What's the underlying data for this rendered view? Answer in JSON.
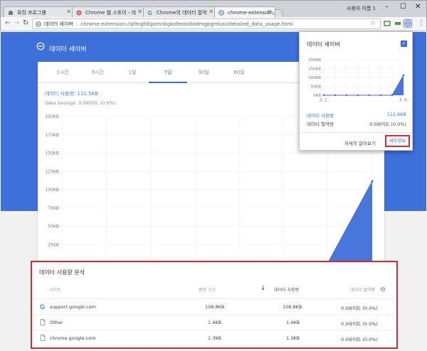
{
  "browser": {
    "tabs": [
      {
        "label": "확장 프로그램"
      },
      {
        "label": "Chrome 웹 스토어 - 데"
      },
      {
        "label": "Chrome의 데이터 절약"
      },
      {
        "label": "chrome-extension://pfm"
      }
    ],
    "username": "사용자 이름 1",
    "window_controls": {
      "minimize": "–",
      "maximize": "☐",
      "close": "✕"
    },
    "address": {
      "site_label": "데이터 세이버",
      "url": "chrome-extension://pfmgfdlgomnbgkofeojodiodmgpgmkac/detailed_data_usage.html"
    }
  },
  "page": {
    "title": "데이터 세이버",
    "range_tabs": [
      "1시간",
      "3시간",
      "1일",
      "7일",
      "30일",
      "60일"
    ],
    "selected_range": "7일",
    "usage_text": "데이터 사용량: 111.5KB",
    "savings_text": "Data Savings: 0.0바이트 (0.0%)"
  },
  "chart_data": [
    {
      "type": "area",
      "title": "",
      "x": [
        "3. 2.",
        "3. 3.",
        "3. 4.",
        "3. 5.",
        "3. 6.",
        "3. 7.",
        "3. 8.",
        "3. 9."
      ],
      "x_tick_labels": [
        "3. 2.",
        "3. 9."
      ],
      "y_ticks": [
        "0KB",
        "25KB",
        "50KB",
        "75KB",
        "100KB",
        "125KB",
        "150KB",
        "175KB",
        "200KB"
      ],
      "series": [
        {
          "values": [
            0,
            0,
            0,
            0,
            0,
            0,
            0,
            111.5
          ]
        }
      ],
      "ylim": [
        0,
        200
      ],
      "grid": true
    },
    {
      "type": "area",
      "title": "",
      "x": [
        "3. 2.",
        "3. 3.",
        "3. 4.",
        "3. 5.",
        "3. 6.",
        "3. 7.",
        "3. 8.",
        "3. 9."
      ],
      "x_tick_labels": [
        "3. 2.",
        "3. 9."
      ],
      "y_ticks": [
        "0KB",
        "50KB",
        "100KB",
        "150KB",
        "200KB"
      ],
      "series": [
        {
          "values": [
            0,
            0,
            0,
            0,
            0,
            0,
            0,
            112.6
          ]
        }
      ],
      "ylim": [
        0,
        200
      ],
      "grid": true
    }
  ],
  "analysis": {
    "title": "데이터 사용량 분석",
    "headers": {
      "site": "사이트",
      "original": "원본 크기",
      "usage": "데이터 사용량",
      "savings": "데이터 절약량"
    },
    "sort_arrow": "↓",
    "rows": [
      {
        "site": "support.google.com",
        "original": "108.8KB",
        "usage": "108.8KB",
        "savings": "0.0바이트 (0.0%)",
        "icon": "google-icon"
      },
      {
        "site": "Other",
        "original": "1.4KB",
        "usage": "1.4KB",
        "savings": "0.0바이트 (0.0%)",
        "icon": "document-icon"
      },
      {
        "site": "chrome.google.com",
        "original": "1.3KB",
        "usage": "1.3KB",
        "savings": "0.0바이트 (0.0%)",
        "icon": "document-icon"
      }
    ]
  },
  "popup": {
    "title": "데이터 세이버",
    "usage_label": "데이터 사용량",
    "usage_value": "112.6KB",
    "savings_label": "데이터 절약량",
    "savings_value": "0.0바이트 (0.0%)",
    "learn_more": "자세히 알아보기",
    "details": "세부정보"
  },
  "colors": {
    "accent": "#3e70d9",
    "highlight": "#e0282a"
  }
}
